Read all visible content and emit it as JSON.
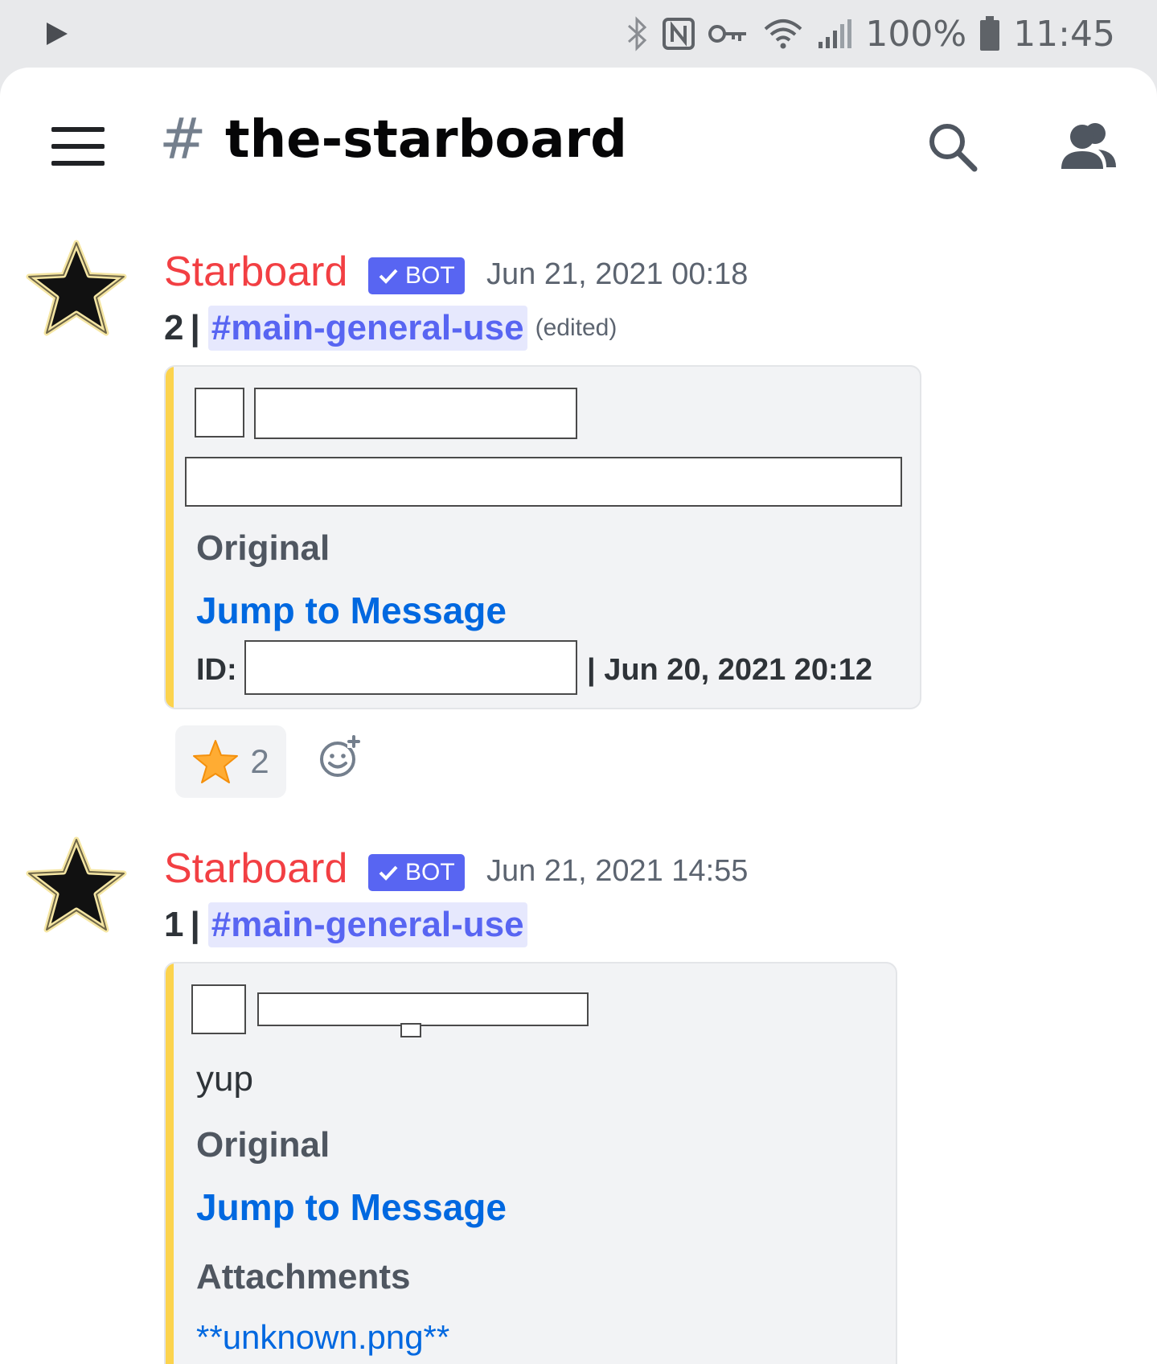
{
  "status_bar": {
    "battery": "100%",
    "time": "11:45",
    "icons": [
      "play-icon",
      "bluetooth-icon",
      "nfc-icon",
      "vpn-key-icon",
      "wifi-icon",
      "signal-icon",
      "battery-icon"
    ]
  },
  "header": {
    "hash": "#",
    "channel": "the-starboard",
    "icons": [
      "hamburger-menu-icon",
      "search-icon",
      "members-icon"
    ]
  },
  "messages": [
    {
      "author": "Starboard",
      "bot_tag": "BOT",
      "timestamp": "Jun 21, 2021 00:18",
      "count": "2",
      "separator": "|",
      "channel_mention": "#main-general-use",
      "edited": "(edited)",
      "embed": {
        "label": "Original",
        "link": "Jump to Message",
        "id_label": "ID:",
        "date": "| Jun 20, 2021 20:12"
      },
      "reaction": {
        "emoji": "star",
        "count": "2"
      }
    },
    {
      "author": "Starboard",
      "bot_tag": "BOT",
      "timestamp": "Jun 21, 2021 14:55",
      "count": "1",
      "separator": "|",
      "channel_mention": "#main-general-use",
      "embed": {
        "text": "yup",
        "label": "Original",
        "link": "Jump to Message",
        "attachments_label": "Attachments",
        "file": "**unknown.png**"
      }
    }
  ],
  "colors": {
    "username": "#f23f43",
    "bot_tag": "#5865f2",
    "link": "#0068e0",
    "embed_accent": "#fcd34d",
    "mention_bg": "#e6e8fd"
  }
}
